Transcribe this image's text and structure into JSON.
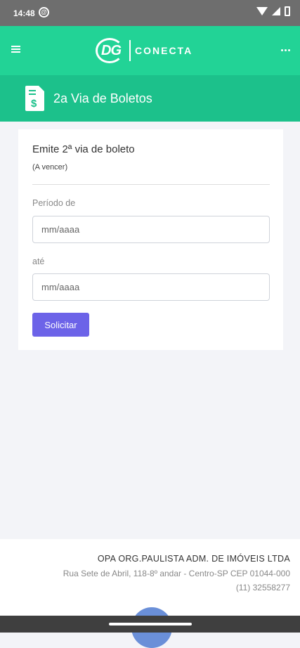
{
  "status": {
    "time": "14:48",
    "icons": [
      "at-sign-icon",
      "wifi-icon",
      "signal-icon",
      "battery-icon"
    ]
  },
  "appbar": {
    "logo_mark": "DG",
    "logo_text": "CONECTA",
    "menu_icon": "hamburger-icon",
    "more_icon": "more-horizontal-icon"
  },
  "page": {
    "title": "2a Via de Boletos",
    "icon": "invoice-dollar-icon"
  },
  "form": {
    "heading": "Emite 2ª via de boleto",
    "subheading": "(A vencer)",
    "from_label": "Período de",
    "from_placeholder": "mm/aaaa",
    "to_label": "até",
    "to_placeholder": "mm/aaaa",
    "submit_label": "Solicitar"
  },
  "footer": {
    "company": "OPA ORG.PAULISTA ADM. DE IMÓVEIS LTDA",
    "address": "Rua Sete de Abril, 118-8º andar - Centro-SP CEP 01044-000",
    "phone": "(11) 32558277"
  },
  "colors": {
    "appbar": "#22d396",
    "titlebar": "#1cc18b",
    "button": "#6c63e8",
    "background": "#f3f4f8"
  }
}
